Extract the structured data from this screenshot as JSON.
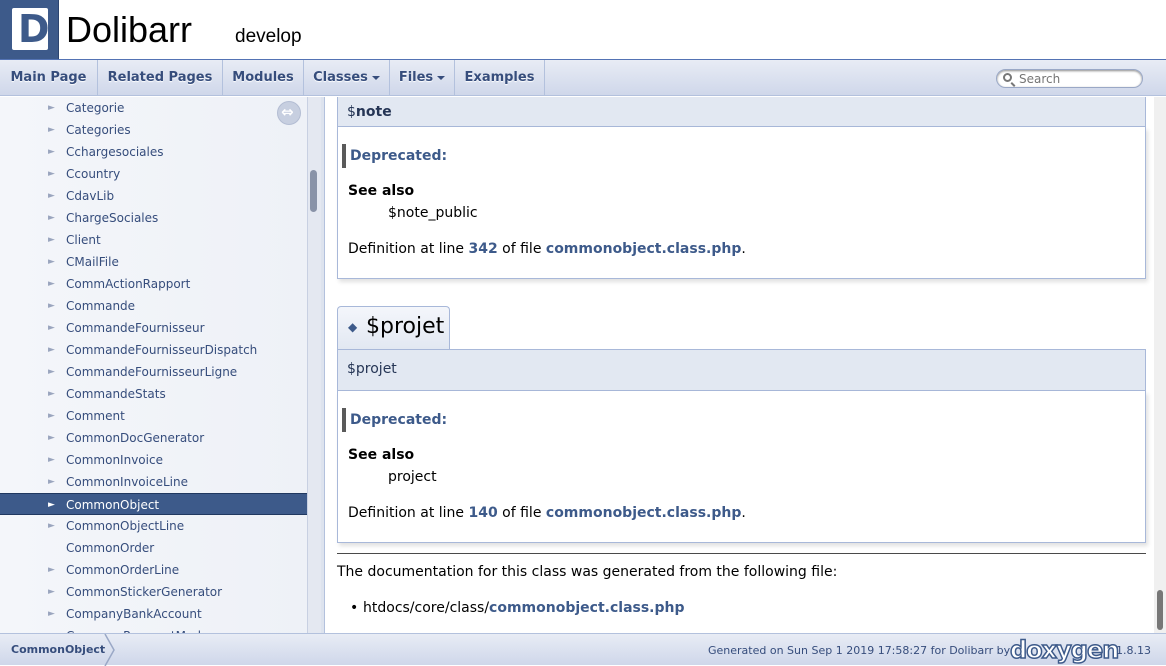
{
  "header": {
    "logo_letter": "D",
    "project_name": "Dolibarr",
    "project_number": "develop"
  },
  "nav": {
    "tabs": [
      "Main Page",
      "Related Pages",
      "Modules",
      "Classes",
      "Files",
      "Examples"
    ],
    "search_placeholder": "Search"
  },
  "sidebar": {
    "items": [
      {
        "label": "Categorie",
        "arrow": "►"
      },
      {
        "label": "Categories",
        "arrow": "►"
      },
      {
        "label": "Cchargesociales",
        "arrow": "►"
      },
      {
        "label": "Ccountry",
        "arrow": "►"
      },
      {
        "label": "CdavLib",
        "arrow": "►"
      },
      {
        "label": "ChargeSociales",
        "arrow": "►"
      },
      {
        "label": "Client",
        "arrow": "►"
      },
      {
        "label": "CMailFile",
        "arrow": "►"
      },
      {
        "label": "CommActionRapport",
        "arrow": "►"
      },
      {
        "label": "Commande",
        "arrow": "►"
      },
      {
        "label": "CommandeFournisseur",
        "arrow": "►"
      },
      {
        "label": "CommandeFournisseurDispatch",
        "arrow": "►"
      },
      {
        "label": "CommandeFournisseurLigne",
        "arrow": "►"
      },
      {
        "label": "CommandeStats",
        "arrow": "►"
      },
      {
        "label": "Comment",
        "arrow": "►"
      },
      {
        "label": "CommonDocGenerator",
        "arrow": "►"
      },
      {
        "label": "CommonInvoice",
        "arrow": "►"
      },
      {
        "label": "CommonInvoiceLine",
        "arrow": "►"
      },
      {
        "label": "CommonObject",
        "arrow": "►",
        "selected": true
      },
      {
        "label": "CommonObjectLine",
        "arrow": "►"
      },
      {
        "label": "CommonOrder",
        "arrow": ""
      },
      {
        "label": "CommonOrderLine",
        "arrow": "►"
      },
      {
        "label": "CommonStickerGenerator",
        "arrow": "►"
      },
      {
        "label": "CompanyBankAccount",
        "arrow": "►"
      },
      {
        "label": "CompanyPaymentMode",
        "arrow": "►"
      }
    ]
  },
  "members": {
    "note": {
      "proto_prefix": "$",
      "proto_name": "note",
      "deprecated": "Deprecated:",
      "see_also": "See also",
      "see_also_value": "$note_public",
      "def_prefix": "Definition at line",
      "def_line": "342",
      "def_mid": "of file",
      "def_file": "commonobject.class.php",
      "def_end": "."
    },
    "projet": {
      "title": "$projet",
      "diamond": "◆",
      "proto": "$projet",
      "deprecated": "Deprecated:",
      "see_also": "See also",
      "see_also_value": "project",
      "def_prefix": "Definition at line",
      "def_line": "140",
      "def_mid": "of file",
      "def_file": "commonobject.class.php",
      "def_end": "."
    }
  },
  "footer_doc": {
    "text": "The documentation for this class was generated from the following file:",
    "bullet": "•",
    "path": "htdocs/core/class/",
    "file": "commonobject.class.php"
  },
  "navpath": {
    "crumb": "CommonObject",
    "generated": "Generated on Sun Sep 1 2019 17:58:27 for Dolibarr by",
    "doxygen": "doxygen",
    "version": "1.8.13"
  }
}
